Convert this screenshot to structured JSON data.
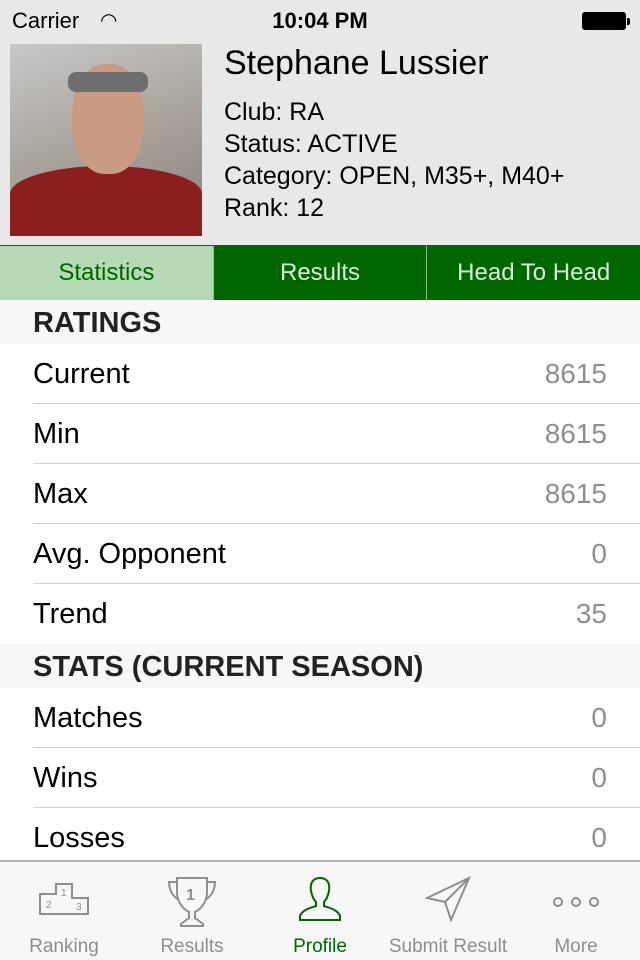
{
  "status_bar": {
    "carrier": "Carrier",
    "time": "10:04 PM"
  },
  "profile": {
    "name": "Stephane Lussier",
    "club": "Club: RA",
    "status": "Status: ACTIVE",
    "category": "Category: OPEN, M35+, M40+",
    "rank": "Rank: 12"
  },
  "segments": [
    {
      "label": "Statistics",
      "selected": true
    },
    {
      "label": "Results"
    },
    {
      "label": "Head To Head"
    }
  ],
  "sections": [
    {
      "title": "RATINGS",
      "rows": [
        {
          "label": "Current",
          "value": "8615"
        },
        {
          "label": "Min",
          "value": "8615"
        },
        {
          "label": "Max",
          "value": "8615"
        },
        {
          "label": "Avg. Opponent",
          "value": "0"
        },
        {
          "label": "Trend",
          "value": "35"
        }
      ]
    },
    {
      "title": "STATS (CURRENT SEASON)",
      "rows": [
        {
          "label": "Matches",
          "value": "0"
        },
        {
          "label": "Wins",
          "value": "0"
        },
        {
          "label": "Losses",
          "value": "0"
        }
      ]
    }
  ],
  "tabbar": [
    {
      "label": "Ranking",
      "icon": "podium-icon"
    },
    {
      "label": "Results",
      "icon": "trophy-icon"
    },
    {
      "label": "Profile",
      "icon": "person-icon",
      "active": true
    },
    {
      "label": "Submit Result",
      "icon": "paper-plane-icon"
    },
    {
      "label": "More",
      "icon": "more-icon"
    }
  ],
  "colors": {
    "accent": "#006600",
    "segment_selected": "#b5dab5",
    "header_bg": "#e8e8e8"
  }
}
